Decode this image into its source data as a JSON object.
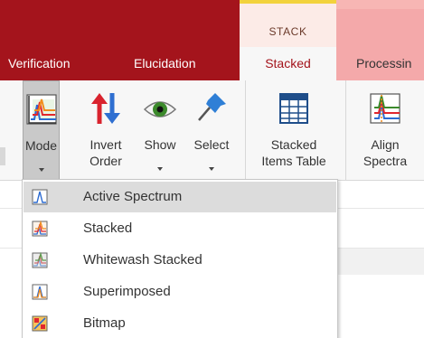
{
  "tabs": {
    "verification": "Verification",
    "elucidation": "Elucidation",
    "context_group": "STACK",
    "stacked": "Stacked",
    "processing": "Processin"
  },
  "ribbon": {
    "mode": {
      "line1": "Mode",
      "icon": "spectrum-mode-icon"
    },
    "invert": {
      "line1": "Invert",
      "line2": "Order",
      "icon": "invert-order-icon"
    },
    "show": {
      "line1": "Show",
      "icon": "eye-icon"
    },
    "select": {
      "line1": "Select",
      "icon": "pushpin-icon"
    },
    "stacked_items": {
      "line1": "Stacked",
      "line2": "Items Table",
      "icon": "table-icon"
    },
    "align": {
      "line1": "Align",
      "line2": "Spectra",
      "icon": "align-spectra-icon"
    }
  },
  "menu": {
    "items": [
      {
        "label": "Active Spectrum",
        "icon": "active-spectrum-icon",
        "active": true
      },
      {
        "label": "Stacked",
        "icon": "stacked-icon",
        "active": false
      },
      {
        "label": "Whitewash Stacked",
        "icon": "whitewash-stacked-icon",
        "active": false
      },
      {
        "label": "Superimposed",
        "icon": "superimposed-icon",
        "active": false
      },
      {
        "label": "Bitmap",
        "icon": "bitmap-icon",
        "active": false
      }
    ]
  },
  "colors": {
    "title_red": "#a4141c",
    "context_yellow": "#f2d23c",
    "context_pink": "#f4a9aa",
    "arrow_red": "#d9232e",
    "arrow_blue": "#2f6fd1",
    "eye_green": "#3c8a2c"
  }
}
